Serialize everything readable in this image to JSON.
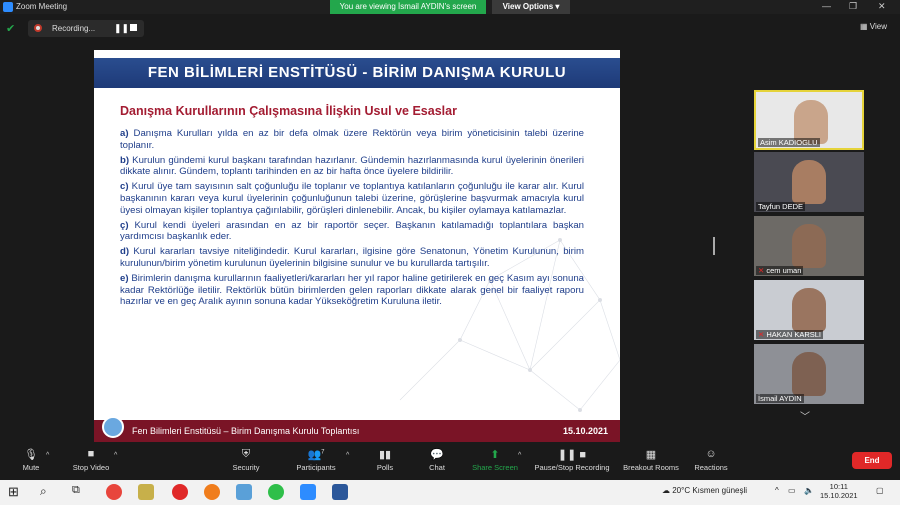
{
  "window": {
    "title": "Zoom Meeting"
  },
  "banner": {
    "viewing": "You are viewing İsmail AYDIN's screen",
    "view_options": "View Options"
  },
  "recording": {
    "label": "Recording..."
  },
  "view_button": "View",
  "slide": {
    "header": "FEN BİLİMLERİ ENSTİTÜSÜ - BİRİM DANIŞMA KURULU",
    "subtitle": "Danışma Kurullarının Çalışmasına İlişkin Usul ve Esaslar",
    "items": [
      {
        "key": "a)",
        "text": "Danışma Kurulları yılda en az bir defa olmak üzere Rektörün veya birim yöneticisinin talebi üzerine toplanır."
      },
      {
        "key": "b)",
        "text": "Kurulun gündemi kurul başkanı tarafından hazırlanır. Gündemin hazırlanmasında kurul üyelerinin önerileri dikkate alınır. Gündem, toplantı tarihinden en az bir hafta önce üyelere bildirilir."
      },
      {
        "key": "c)",
        "text": "Kurul üye tam sayısının salt çoğunluğu ile toplanır ve toplantıya katılanların çoğunluğu ile karar alır. Kurul başkanının kararı veya kurul üyelerinin çoğunluğunun talebi üzerine, görüşlerine başvurmak amacıyla kurul üyesi olmayan kişiler toplantıya çağırılabilir, görüşleri dinlenebilir. Ancak, bu kişiler oylamaya katılamazlar."
      },
      {
        "key": "ç)",
        "text": "Kurul kendi üyeleri arasından en az bir raportör seçer. Başkanın katılamadığı toplantılara başkan yardımcısı başkanlık eder."
      },
      {
        "key": "d)",
        "text": "Kurul kararları tavsiye niteliğindedir. Kurul kararları, ilgisine göre Senatonun, Yönetim Kurulunun, birim kurulunun/birim yönetim kurulunun üyelerinin bilgisine sunulur ve bu kurullarda tartışılır."
      },
      {
        "key": "e)",
        "text": "Birimlerin danışma kurullarının faaliyetleri/kararları her yıl rapor haline getirilerek en geç Kasım ayı sonuna kadar Rektörlüğe iletilir. Rektörlük bütün birimlerden gelen raporları dikkate alarak genel bir faaliyet raporu hazırlar ve en geç Aralık ayının sonuna kadar Yükseköğretim Kuruluna iletir."
      }
    ],
    "footer_title": "Fen Bilimleri Enstitüsü – Birim Danışma Kurulu Toplantısı",
    "footer_date": "15.10.2021"
  },
  "participants": [
    {
      "name": "Asim KADIOGLU"
    },
    {
      "name": "Tayfun DEDE"
    },
    {
      "name": "cem uman"
    },
    {
      "name": "HAKAN KARSLI"
    },
    {
      "name": "İsmail AYDIN"
    }
  ],
  "toolbar": {
    "mute": "Mute",
    "stop_video": "Stop Video",
    "security": "Security",
    "participants": "Participants",
    "participants_count": "7",
    "polls": "Polls",
    "chat": "Chat",
    "share_screen": "Share Screen",
    "pause_recording": "Pause/Stop Recording",
    "breakout": "Breakout Rooms",
    "reactions": "Reactions",
    "end": "End"
  },
  "taskbar": {
    "weather": "20°C  Kısmen güneşli",
    "time": "10:11",
    "date": "15.10.2021"
  },
  "colors": {
    "share_green": "#23a74c",
    "end_red": "#e02828",
    "active_speaker": "#e5d33a"
  }
}
